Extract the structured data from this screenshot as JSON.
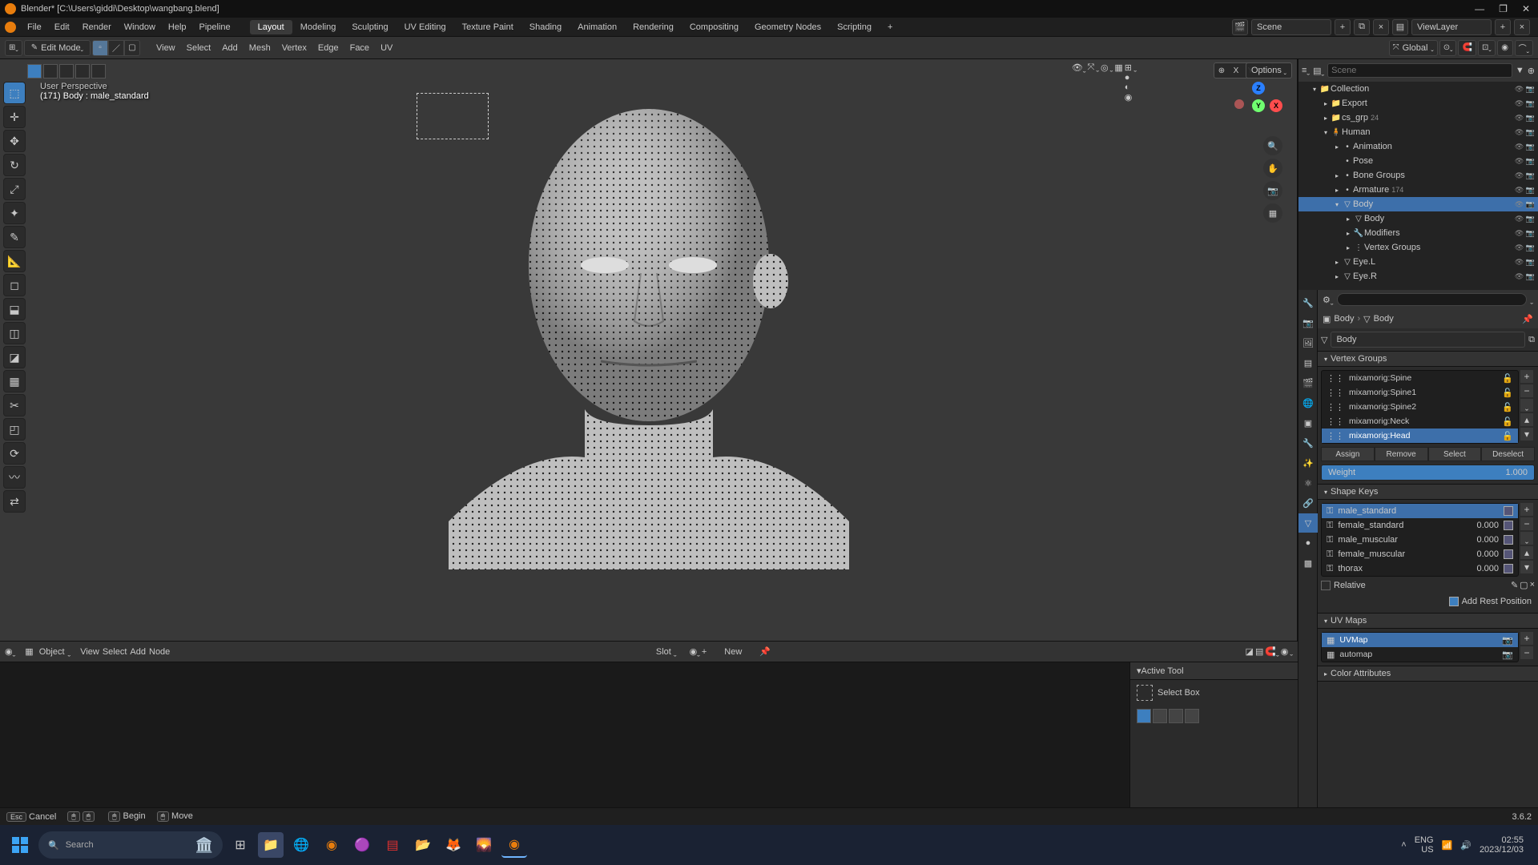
{
  "title": "Blender* [C:\\Users\\giddi\\Desktop\\wangbang.blend]",
  "menu": {
    "file": "File",
    "edit": "Edit",
    "render": "Render",
    "window": "Window",
    "help": "Help",
    "pipeline": "Pipeline"
  },
  "workspaces": [
    "Layout",
    "Modeling",
    "Sculpting",
    "UV Editing",
    "Texture Paint",
    "Shading",
    "Animation",
    "Rendering",
    "Compositing",
    "Geometry Nodes",
    "Scripting"
  ],
  "scene": {
    "label": "Scene",
    "viewlayer": "ViewLayer"
  },
  "editmode": "Edit Mode",
  "toolbar": {
    "view": "View",
    "select": "Select",
    "add": "Add",
    "mesh": "Mesh",
    "vertex": "Vertex",
    "edge": "Edge",
    "face": "Face",
    "uv": "UV",
    "global": "Global"
  },
  "axis": {
    "x": "X",
    "y": "Y",
    "z": "Z"
  },
  "options": "Options",
  "viewport": {
    "persp": "User Perspective",
    "obj": "(171) Body : male_standard"
  },
  "nodegraph": {
    "object": "Object",
    "view": "View",
    "select": "Select",
    "add": "Add",
    "node": "Node",
    "slot": "Slot",
    "new": "New"
  },
  "activetool": {
    "header": "Active Tool",
    "tool": "Select Box"
  },
  "outliner": {
    "items": [
      {
        "depth": 1,
        "icon": "▾",
        "name": "Collection",
        "type": "col"
      },
      {
        "depth": 2,
        "icon": "▸",
        "name": "Export",
        "type": "col"
      },
      {
        "depth": 2,
        "icon": "▸",
        "name": "cs_grp",
        "type": "col",
        "extra": "24"
      },
      {
        "depth": 2,
        "icon": "▾",
        "name": "Human",
        "type": "arm"
      },
      {
        "depth": 3,
        "icon": "▸",
        "name": "Animation",
        "type": "data"
      },
      {
        "depth": 3,
        "icon": "",
        "name": "Pose",
        "type": "data"
      },
      {
        "depth": 3,
        "icon": "▸",
        "name": "Bone Groups",
        "type": "data"
      },
      {
        "depth": 3,
        "icon": "▸",
        "name": "Armature",
        "type": "data",
        "extra": "174"
      },
      {
        "depth": 3,
        "icon": "▾",
        "name": "Body",
        "type": "mesh",
        "sel": true
      },
      {
        "depth": 4,
        "icon": "▸",
        "name": "Body",
        "type": "meshdata"
      },
      {
        "depth": 4,
        "icon": "▸",
        "name": "Modifiers",
        "type": "mod"
      },
      {
        "depth": 4,
        "icon": "▸",
        "name": "Vertex Groups",
        "type": "vg"
      },
      {
        "depth": 3,
        "icon": "▸",
        "name": "Eye.L",
        "type": "mesh"
      },
      {
        "depth": 3,
        "icon": "▸",
        "name": "Eye.R",
        "type": "mesh"
      }
    ]
  },
  "props": {
    "crumb1": "Body",
    "crumb2": "Body",
    "meshname": "Body",
    "vg_header": "Vertex Groups",
    "vgroups": [
      "mixamorig:Spine",
      "mixamorig:Spine1",
      "mixamorig:Spine2",
      "mixamorig:Neck",
      "mixamorig:Head"
    ],
    "vg_sel": 4,
    "assign": "Assign",
    "remove": "Remove",
    "select": "Select",
    "deselect": "Deselect",
    "weight_label": "Weight",
    "weight_value": "1.000",
    "sk_header": "Shape Keys",
    "shapekeys": [
      {
        "n": "male_standard",
        "v": ""
      },
      {
        "n": "female_standard",
        "v": "0.000"
      },
      {
        "n": "male_muscular",
        "v": "0.000"
      },
      {
        "n": "female_muscular",
        "v": "0.000"
      },
      {
        "n": "thorax",
        "v": "0.000"
      }
    ],
    "sk_sel": 0,
    "relative": "Relative",
    "addrest": "Add Rest Position",
    "uv_header": "UV Maps",
    "uvmaps": [
      "UVMap",
      "automap"
    ],
    "ca_header": "Color Attributes"
  },
  "status": {
    "cancel": "Cancel",
    "begin": "Begin",
    "move": "Move",
    "version": "3.6.2"
  },
  "taskbar": {
    "search": "Search",
    "lang1": "ENG",
    "lang2": "US",
    "time": "02:55",
    "date": "2023/12/03"
  }
}
